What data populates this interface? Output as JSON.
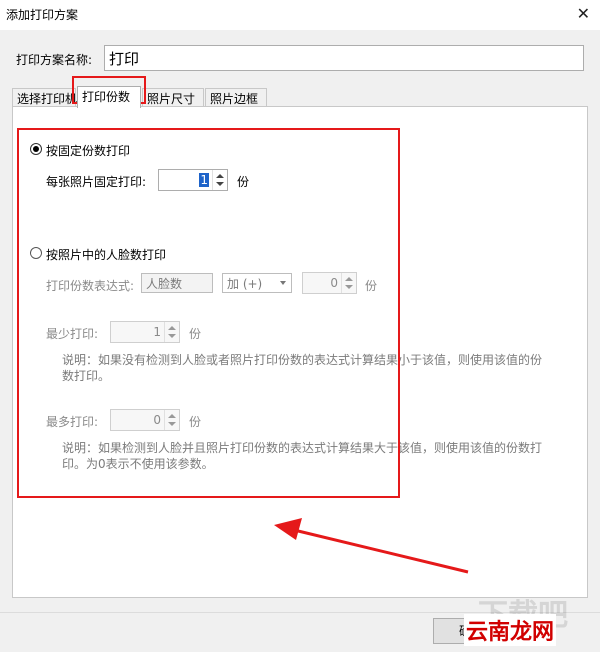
{
  "window": {
    "title": "添加打印方案"
  },
  "name_field": {
    "label": "打印方案名称:",
    "value": "打印"
  },
  "tabs": [
    {
      "label": "选择打印机"
    },
    {
      "label": "打印份数"
    },
    {
      "label": "照片尺寸"
    },
    {
      "label": "照片边框"
    }
  ],
  "fixed_mode": {
    "radio_label": "按固定份数打印",
    "selected": true,
    "per_photo_label": "每张照片固定打印:",
    "per_photo_value": "1",
    "unit": "份"
  },
  "face_mode": {
    "radio_label": "按照片中的人脸数打印",
    "selected": false,
    "expr_label": "打印份数表达式:",
    "expr_value": "人脸数",
    "operator_value": "加 (+)",
    "operand_value": "0",
    "unit": "份",
    "min_label": "最少打印:",
    "min_value": "1",
    "min_unit": "份",
    "min_desc_line1": "说明：如果没有检测到人脸或者照片打印份数的表达式计算结果小于该值，则使用该值的份",
    "min_desc_line2": "数打印。",
    "max_label": "最多打印:",
    "max_value": "0",
    "max_unit": "份",
    "max_desc_line1": "说明：如果检测到人脸并且照片打印份数的表达式计算结果大于该值，则使用该值的份数打",
    "max_desc_line2": "印。为0表示不使用该参数。"
  },
  "buttons": {
    "ok_label": "确定"
  },
  "watermark": {
    "text": "下载吧",
    "site_text": "云南龙网"
  },
  "colors": {
    "annotation_red": "#e5191a",
    "selection_blue": "#1e63c9"
  }
}
